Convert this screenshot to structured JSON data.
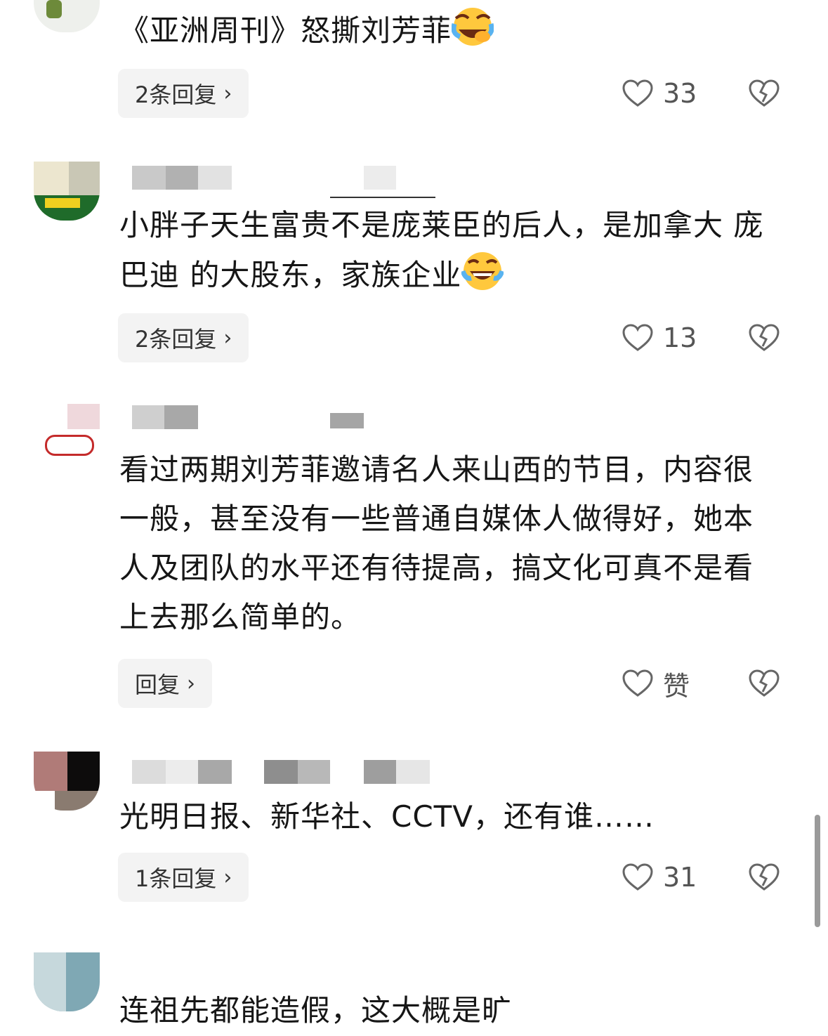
{
  "comments": [
    {
      "text": "《亚洲周刊》怒撕刘芳菲",
      "emoji": "laughing-crying-face-icon",
      "reply_label": "2条回复",
      "likes": "33"
    },
    {
      "text": "小胖子天生富贵不是庞莱臣的后人，是加拿大 庞巴迪 的大股东，家族企业",
      "emoji": "tears-of-joy-face-icon",
      "reply_label": "2条回复",
      "likes": "13"
    },
    {
      "text": "看过两期刘芳菲邀请名人来山西的节目，内容很一般，甚至没有一些普通自媒体人做得好，她本人及团队的水平还有待提高，搞文化可真不是看上去那么简单的。",
      "reply_label": "回复",
      "likes": "赞"
    },
    {
      "text": "光明日报、新华社、CCTV，还有谁……",
      "reply_label": "1条回复",
      "likes": "31"
    },
    {
      "text": "连祖先都能造假，这大概是旷"
    }
  ],
  "chevron": "›",
  "colors": {
    "reply_bg": "#f3f3f3",
    "text": "#161616",
    "muted": "#555555"
  }
}
